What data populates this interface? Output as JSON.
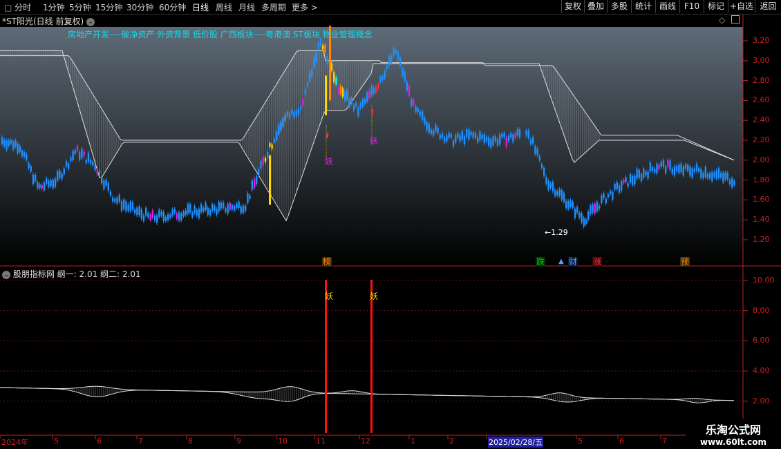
{
  "toolbar": {
    "timeframes": [
      "分时",
      "1分钟",
      "5分钟",
      "15分钟",
      "30分钟",
      "60分钟",
      "日线",
      "周线",
      "月线",
      "多周期",
      "更多 >"
    ],
    "active": "日线",
    "buttons": [
      "复权",
      "叠加",
      "多股",
      "统计",
      "画线",
      "F10",
      "标记",
      "+自选",
      "返回"
    ]
  },
  "main_panel": {
    "title": "*ST阳光(日线 前复权)",
    "concepts": "房地产开发----破净资产 外资背景 低价股 广西板块----粤港澳 ST板块 物业管理概念",
    "y_ticks": [
      "3.20",
      "3.00",
      "2.80",
      "2.60",
      "2.40",
      "2.20",
      "2.00",
      "1.80",
      "1.60",
      "1.40",
      "1.20"
    ],
    "low_marker": "1.29",
    "yao_label": "妖",
    "event_tags": [
      {
        "text": "榜",
        "color": "#ff8800"
      },
      {
        "text": "跌",
        "color": "#00cc00"
      },
      {
        "text": "财",
        "color": "#4fa0ff"
      },
      {
        "text": "涨",
        "color": "#ff3030"
      },
      {
        "text": "预",
        "color": "#ff8800"
      }
    ]
  },
  "indicator_panel": {
    "title": "股朋指标网 纲一: 2.01 纲二: 2.01",
    "y_ticks": [
      "10.00",
      "8.00",
      "6.00",
      "4.00",
      "2.00"
    ],
    "yao_label": "妖"
  },
  "x_axis": {
    "labels": [
      "2024年",
      "5",
      "6",
      "7",
      "8",
      "9",
      "10",
      "11",
      "12",
      "1",
      "2",
      "2025/02/28/五",
      "5",
      "6",
      "7"
    ]
  },
  "watermark": {
    "title": "乐淘公式网",
    "url": "www.60lt.com"
  },
  "colors": {
    "up": "#1e90ff",
    "spike": "#ffd700",
    "accent": "#e020e0",
    "axis": "#d02020"
  },
  "chart_data": [
    {
      "type": "candlestick",
      "title": "*ST阳光(日线 前复权)",
      "ylim": [
        1.1,
        3.35
      ],
      "approx_close_path": [
        2.2,
        2.15,
        1.72,
        1.8,
        2.1,
        1.95,
        1.62,
        1.5,
        1.42,
        1.45,
        1.48,
        1.5,
        1.52,
        1.55,
        2.0,
        2.4,
        2.55,
        3.2,
        2.7,
        2.5,
        2.75,
        3.1,
        2.5,
        2.3,
        2.2,
        2.25,
        2.2,
        2.22,
        2.3,
        1.8,
        1.6,
        1.4,
        1.6,
        1.75,
        1.85,
        1.95,
        1.9,
        1.9,
        1.85,
        1.8
      ],
      "annotations": [
        "1.29",
        "妖",
        "妖"
      ]
    },
    {
      "type": "line",
      "title": "股朋指标网 纲一: 2.01 纲二: 2.01",
      "ylim": [
        0,
        11
      ],
      "series": [
        {
          "name": "纲一",
          "last": 2.01
        },
        {
          "name": "纲二",
          "last": 2.01
        }
      ]
    }
  ]
}
